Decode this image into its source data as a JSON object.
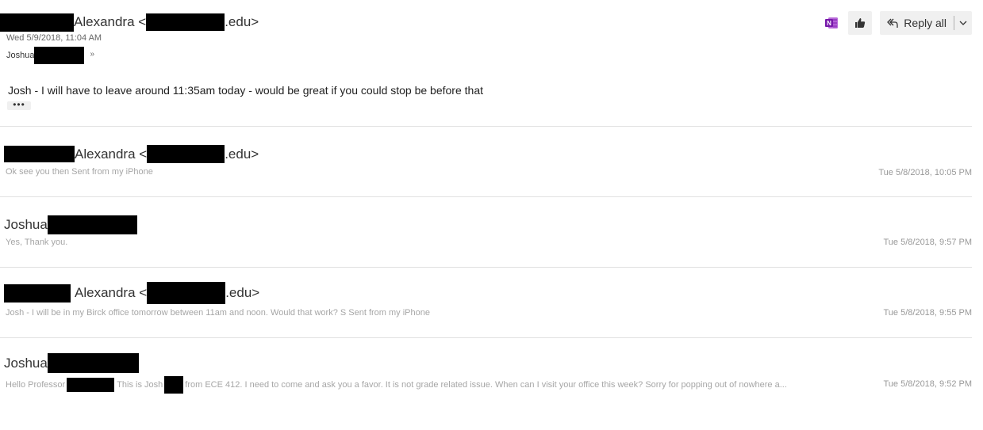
{
  "message": {
    "sender_name": "Alexandra <",
    "sender_domain": ".edu>",
    "date": "Wed 5/9/2018, 11:04 AM",
    "recipient": "Joshua",
    "body": "Josh - I will have to leave around 11:35am today - would be great if you could stop be before that",
    "more_label": "•••"
  },
  "actions": {
    "reply_all_label": "Reply all"
  },
  "thread": [
    {
      "name": "Alexandra <",
      "domain": ".edu>",
      "preview": "Ok see you then Sent from my iPhone",
      "time": "Tue 5/8/2018, 10:05 PM"
    },
    {
      "name": "Joshua",
      "preview": "Yes, Thank you.",
      "time": "Tue 5/8/2018, 9:57 PM"
    },
    {
      "name": "Alexandra <",
      "domain": ".edu>",
      "preview": "Josh - I will be in my Birck office tomorrow between 11am and noon. Would that work? S Sent from my iPhone",
      "time": "Tue 5/8/2018, 9:55 PM"
    },
    {
      "name": "Joshua",
      "preview_before": "Hello Professor",
      "preview_middle": "This is Josh",
      "preview_after": "from ECE 412. I need to come and ask you a favor. It is not grade related issue. When can I visit your office this week? Sorry for popping out of nowhere a...",
      "time": "Tue 5/8/2018, 9:52 PM"
    }
  ],
  "colors": {
    "onenote": "#7719aa",
    "redaction": "#000000",
    "divider": "#e1e1e1"
  },
  "icons": {
    "onenote": "onenote-icon",
    "like": "like-icon",
    "reply_all": "reply-all-icon",
    "chevron": "chevron-down-icon",
    "expand": "expand-recipients-icon"
  }
}
